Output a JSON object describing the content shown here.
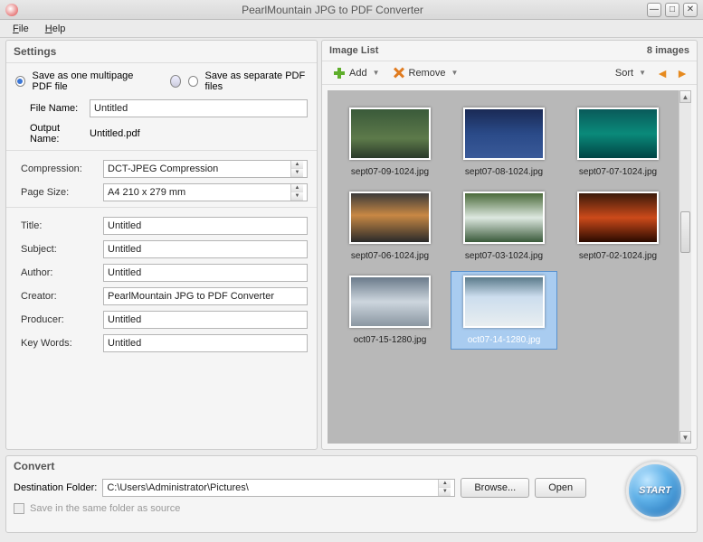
{
  "window": {
    "title": "PearlMountain JPG to PDF Converter"
  },
  "menu": {
    "file": "File",
    "help": "Help"
  },
  "settings": {
    "title": "Settings",
    "save_one": "Save as one multipage PDF file",
    "save_sep": "Save as separate PDF files",
    "filename_label": "File Name:",
    "filename": "Untitled",
    "outputname_label": "Output Name:",
    "outputname": "Untitled.pdf",
    "compression_label": "Compression:",
    "compression": "DCT-JPEG Compression",
    "pagesize_label": "Page Size:",
    "pagesize": "A4 210 x 279 mm",
    "title_label": "Title:",
    "title_val": "Untitled",
    "subject_label": "Subject:",
    "subject": "Untitled",
    "author_label": "Author:",
    "author": "Untitled",
    "creator_label": "Creator:",
    "creator": "PearlMountain JPG to PDF Converter",
    "producer_label": "Producer:",
    "producer": "Untitled",
    "keywords_label": "Key Words:",
    "keywords": "Untitled"
  },
  "imagelist": {
    "title": "Image List",
    "count": "8 images",
    "add": "Add",
    "remove": "Remove",
    "sort": "Sort",
    "items": [
      {
        "label": "sept07-09-1024.jpg"
      },
      {
        "label": "sept07-08-1024.jpg"
      },
      {
        "label": "sept07-07-1024.jpg"
      },
      {
        "label": "sept07-06-1024.jpg"
      },
      {
        "label": "sept07-03-1024.jpg"
      },
      {
        "label": "sept07-02-1024.jpg"
      },
      {
        "label": "oct07-15-1280.jpg"
      },
      {
        "label": "oct07-14-1280.jpg"
      }
    ]
  },
  "convert": {
    "title": "Convert",
    "dest_label": "Destination Folder:",
    "dest": "C:\\Users\\Administrator\\Pictures\\",
    "browse": "Browse...",
    "open": "Open",
    "same_folder": "Save in the same folder as source",
    "start": "START"
  }
}
